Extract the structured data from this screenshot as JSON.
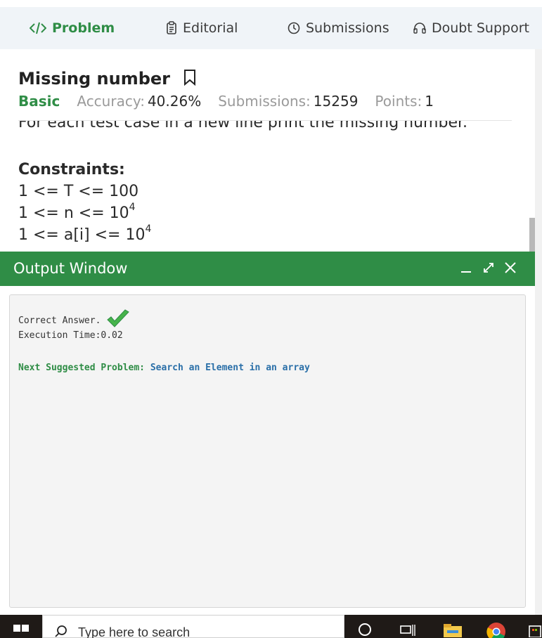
{
  "tabs": [
    {
      "label": "Problem",
      "icon": "code-icon",
      "active": true
    },
    {
      "label": "Editorial",
      "icon": "document-icon",
      "active": false
    },
    {
      "label": "Submissions",
      "icon": "clock-icon",
      "active": false
    },
    {
      "label": "Doubt Support",
      "icon": "headset-icon",
      "active": false
    }
  ],
  "problem": {
    "title": "Missing number",
    "level": "Basic",
    "accuracy_label": "Accuracy:",
    "accuracy_value": "40.26%",
    "submissions_label": "Submissions:",
    "submissions_value": "15259",
    "points_label": "Points:",
    "points_value": "1",
    "output_line": "For each test case in a new line print the missing number.",
    "constraints_heading": "Constraints:",
    "constraints": [
      {
        "text": "1 <= T <= 100",
        "sup": ""
      },
      {
        "text": "1 <= n <= 10",
        "sup": "4"
      },
      {
        "text": "1 <= a[i] <= 10",
        "sup": "4"
      }
    ]
  },
  "output_window": {
    "title": "Output Window",
    "result": "Correct Answer.",
    "execution": "Execution Time:0.02",
    "next_label": "Next Suggested Problem:",
    "next_link": "Search an Element in an array"
  },
  "taskbar": {
    "search_placeholder": "Type here to search"
  },
  "colors": {
    "brand_green": "#2f8d46",
    "link_blue": "#2a6fa8"
  }
}
